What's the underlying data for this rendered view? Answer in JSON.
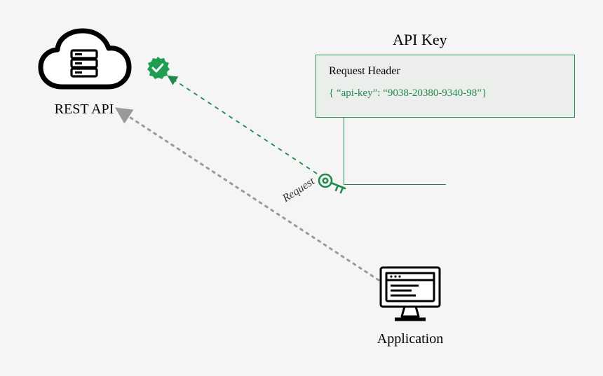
{
  "rest_api": {
    "label": "REST API"
  },
  "api_key": {
    "title": "API Key",
    "header_title": "Request Header",
    "header_body": "{ “api-key”: “9038-20380-9340-98”}"
  },
  "request": {
    "label": "Request"
  },
  "application": {
    "label": "Application"
  },
  "colors": {
    "green": "#1e8a4c",
    "grey": "#9a9a9a",
    "black": "#000000"
  }
}
